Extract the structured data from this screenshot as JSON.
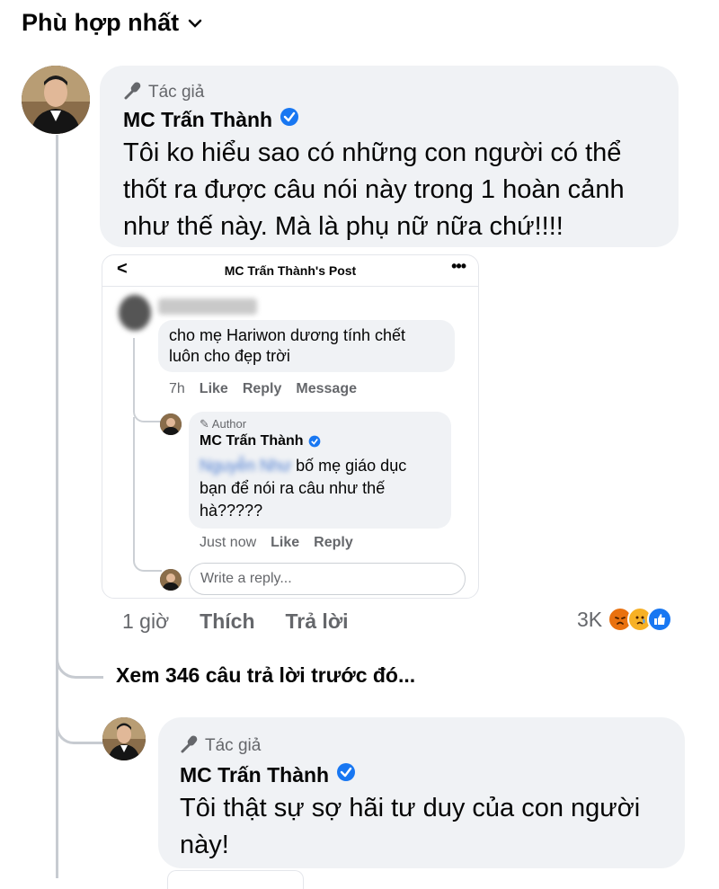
{
  "sort": {
    "label": "Phù hợp nhất"
  },
  "comment1": {
    "author_tag": "Tác giả",
    "name": "MC Trấn Thành",
    "text_lines": [
      "Tôi ko hiểu sao có những con người có thể",
      "thốt ra được câu nói này trong 1 hoàn cảnh",
      "như thế này. Mà là phụ nữ nữa chứ!!!!"
    ],
    "time": "1 giờ",
    "like": "Thích",
    "reply": "Trả lời",
    "reaction_count": "3K",
    "reactions": [
      "angry",
      "sad",
      "like"
    ]
  },
  "screenshot": {
    "title": "MC Trấn Thành's Post",
    "comment": {
      "name_blurred": "Nguyễn Nhu",
      "lines": [
        "cho mẹ Hariwon dương tính chết",
        "luôn cho đẹp trời"
      ],
      "time": "7h",
      "like": "Like",
      "reply": "Reply",
      "message": "Message"
    },
    "reply": {
      "author_tag": "Author",
      "name": "MC Trấn Thành",
      "mention_blurred": "Nguyễn Như",
      "lines": [
        "bố mẹ giáo dục",
        "bạn để nói ra câu như thế",
        "hà?????"
      ],
      "time": "Just now",
      "like": "Like",
      "reply": "Reply"
    },
    "input_placeholder": "Write a reply..."
  },
  "view_more": "Xem 346 câu trả lời trước đó...",
  "comment2": {
    "author_tag": "Tác giả",
    "name": "MC Trấn Thành",
    "text_lines": [
      "Tôi thật sự sợ hãi tư duy của con người",
      "này!"
    ]
  },
  "colors": {
    "verified": "#1877f2",
    "bubble": "#f0f2f5",
    "muted": "#65676b"
  }
}
